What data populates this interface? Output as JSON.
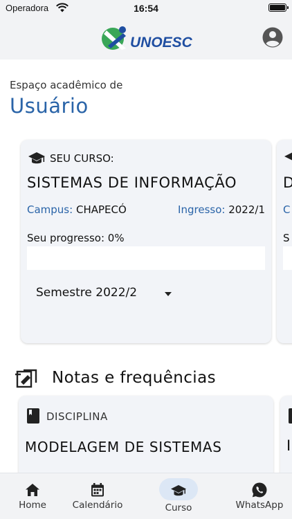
{
  "status_bar": {
    "carrier": "Operadora",
    "time": "16:54"
  },
  "app_bar": {
    "logo_text": "UNOESC",
    "icons": {
      "account": "account-circle-icon"
    }
  },
  "greeting": {
    "subtitle": "Espaço acadêmico de",
    "name": "Usuário"
  },
  "course_card": {
    "header": "SEU CURSO:",
    "course_name": "SISTEMAS DE INFORMAÇÃO",
    "campus_label": "Campus:",
    "campus_value": "CHAPECÓ",
    "ingresso_label": "Ingresso:",
    "ingresso_value": "2022/1",
    "progress_label": "Seu progresso: 0%",
    "progress_fraction": 0,
    "semester_selected": "Semestre 2022/2"
  },
  "course_card_peek": {
    "header_letter": "",
    "name_letter": "D",
    "campus_letter": "C",
    "progress_letter": "S"
  },
  "notes_section": {
    "title": "Notas e frequências",
    "icon": "grades-icon"
  },
  "subject_card": {
    "label": "DISCIPLINA",
    "name": "MODELAGEM DE SISTEMAS"
  },
  "subject_card_peek": {
    "name_letter": "I"
  },
  "bottom_nav": {
    "items": [
      {
        "label": "Home",
        "icon": "home-icon"
      },
      {
        "label": "Calendário",
        "icon": "calendar-icon"
      },
      {
        "label": "Curso",
        "icon": "graduation-cap-icon",
        "active": true
      },
      {
        "label": "WhatsApp",
        "icon": "whatsapp-icon"
      }
    ]
  },
  "colors": {
    "accent": "#2a64a8",
    "brand_blue": "#1f4ea1",
    "brand_green": "#3aa657",
    "card_bg": "#f2f4f8",
    "active_pill": "#dce7f5"
  }
}
